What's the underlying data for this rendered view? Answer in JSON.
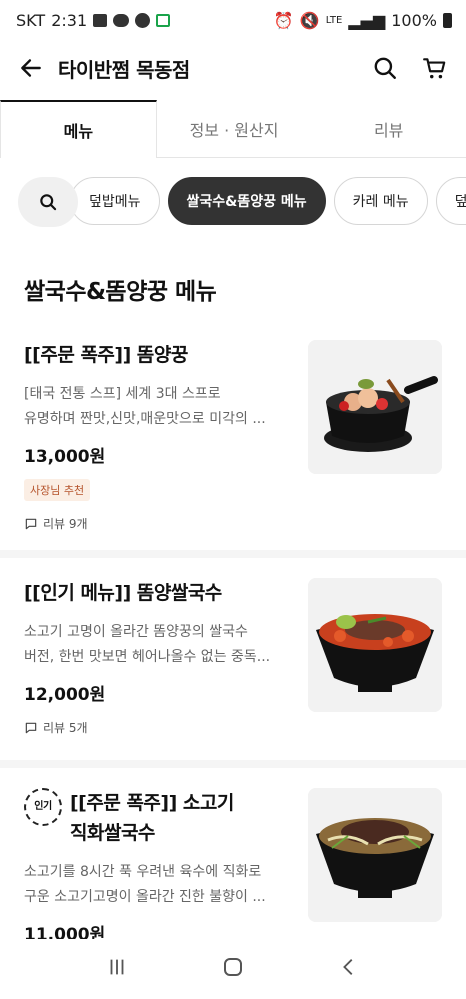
{
  "status": {
    "carrier": "SKT",
    "time": "2:31",
    "battery": "100%",
    "network": "LTE"
  },
  "header": {
    "title": "타이반쩜 목동점"
  },
  "tabs": [
    {
      "label": "메뉴"
    },
    {
      "label": "정보 · 원산지"
    },
    {
      "label": "리뷰"
    }
  ],
  "chips": [
    "덮밥메뉴",
    "쌀국수&똠양꿍 메뉴",
    "카레 메뉴",
    "덮밥"
  ],
  "section_title": "쌀국수&똠양꿍 메뉴",
  "items": [
    {
      "name": "[[주문 폭주]] 똠양꿍",
      "desc1": "[태국 전통 스프] 세계 3대 스프로",
      "desc2": "유명하며 짠맛,신맛,매운맛으로 미각의 ...",
      "price": "13,000원",
      "badge": "사장님 추천",
      "review": "리뷰 9개"
    },
    {
      "name": "[[인기 메뉴]] 똠양쌀국수",
      "desc1": "소고기 고명이 올라간 똠양꿍의 쌀국수",
      "desc2": "버전, 한번 맛보면 헤어나올수 없는 중독...",
      "price": "12,000원",
      "review": "리뷰 5개"
    },
    {
      "popular_tag": "인기",
      "name1": "[[주문 폭주]] 소고기",
      "name2": "직화쌀국수",
      "desc1": "소고기를 8시간 푹 우려낸 육수에 직화로",
      "desc2": "구운 소고기고명이 올라간 진한 불향이 ...",
      "price": "11,000원"
    }
  ]
}
